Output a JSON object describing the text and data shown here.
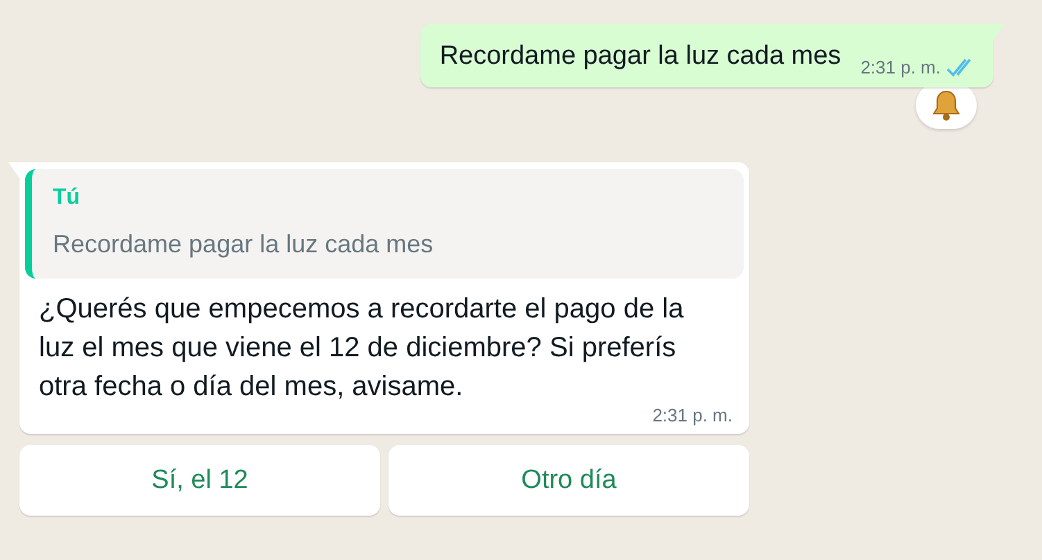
{
  "messages": [
    {
      "kind": "outgoing",
      "text": "Recordame pagar la luz cada mes",
      "time": "2:31 p. m.",
      "read": true,
      "reaction": {
        "kind": "bell"
      }
    },
    {
      "kind": "incoming",
      "quote": {
        "author": "Tú",
        "text": "Recordame pagar la luz cada mes"
      },
      "text": "¿Querés que empecemos a recordarte el pago de la luz el mes que viene el 12 de diciembre? Si preferís otra fecha o día del mes, avisame.",
      "time": "2:31 p. m."
    }
  ],
  "quick_replies": [
    "Sí, el 12",
    "Otro día"
  ]
}
